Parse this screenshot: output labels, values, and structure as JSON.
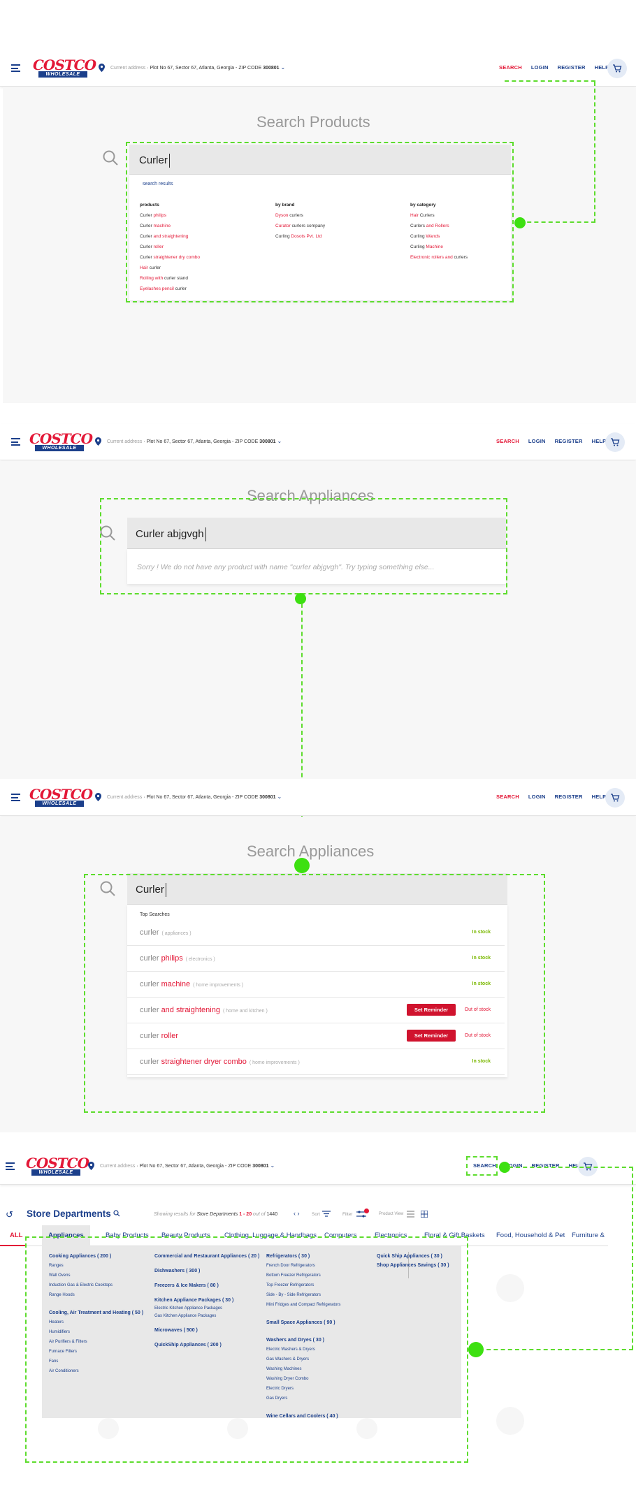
{
  "header": {
    "logo_text": "COSTCO",
    "logo_subtext": "WHOLESALE",
    "address_label": "Current address",
    "address": "Plot No 67, Sector 67, Atlanta, Georgia",
    "zip_label": "ZIP CODE",
    "zip": "300801",
    "nav": {
      "search": "SEARCH",
      "login": "LOGIN",
      "register": "REGISTER",
      "help": "HELP"
    }
  },
  "panel1": {
    "title": "Search Products",
    "query": "Curler",
    "results_link": "search results",
    "columns": [
      {
        "heading": "products",
        "rows": [
          {
            "base": "Curler ",
            "hl": "philips",
            "tail": ""
          },
          {
            "base": "Curler ",
            "hl": "machine",
            "tail": ""
          },
          {
            "base": "Curler ",
            "hl": "and straightening",
            "tail": ""
          },
          {
            "base": "Curler ",
            "hl": "roller",
            "tail": ""
          },
          {
            "base": "Curler ",
            "hl": "straightener dry combo",
            "tail": ""
          },
          {
            "base": "",
            "hl": "Hair",
            "tail": " curler"
          },
          {
            "base": "",
            "hl": "Rolling with",
            "tail": " curler stand"
          },
          {
            "base": "",
            "hl": "Eyelashes pencil",
            "tail": " curler"
          }
        ]
      },
      {
        "heading": "by brand",
        "rows": [
          {
            "base": "",
            "hl": "Dyson",
            "tail": " curlers"
          },
          {
            "base": "",
            "hl": "Curator",
            "tail": " curlers company"
          },
          {
            "base": "Curling ",
            "hl": "Dosots Pvt. Ltd",
            "tail": ""
          }
        ]
      },
      {
        "heading": "by category",
        "rows": [
          {
            "base": "",
            "hl": "Hair",
            "tail": " Curlers"
          },
          {
            "base": "Curlers ",
            "hl": "and Rollers",
            "tail": ""
          },
          {
            "base": "Curling ",
            "hl": "Wands",
            "tail": ""
          },
          {
            "base": "Curling ",
            "hl": "Machine",
            "tail": ""
          },
          {
            "base": "",
            "hl": "Electronic rollers and",
            "tail": " curlers"
          }
        ]
      }
    ]
  },
  "panel2": {
    "title": "Search Appliances",
    "query": "Curler abjgvgh",
    "message": "Sorry ! We do not have any product with name \"curler abjgvgh\". Try typing something else..."
  },
  "panel3": {
    "title": "Search Appliances",
    "query": "Curler",
    "top_label": "Top Searches",
    "reminder_label": "Set Reminder",
    "rows": [
      {
        "base": "curler",
        "hl": "",
        "cat": "( appliances )",
        "status": "In stock",
        "oos": false
      },
      {
        "base": "curler ",
        "hl": "philips",
        "cat": "( electronics )",
        "status": "In stock",
        "oos": false
      },
      {
        "base": "curler ",
        "hl": "machine",
        "cat": "( home improvements )",
        "status": "In stock",
        "oos": false
      },
      {
        "base": "curler ",
        "hl": "and straightening",
        "cat": "( home and kitchen )",
        "status": "Out of stock",
        "oos": true
      },
      {
        "base": "curler ",
        "hl": "roller",
        "cat": "",
        "status": "Out of stock",
        "oos": true
      },
      {
        "base": "curler ",
        "hl": "straightener dryer combo",
        "cat": "( home improvements )",
        "status": "In stock",
        "oos": false
      }
    ]
  },
  "panel4": {
    "title": "Store Departments",
    "showing": "Showing results for",
    "showing_dept": "Store Departments",
    "range": "1 - 20",
    "out_of": "out of",
    "total": "1440",
    "sort_label": "Sort",
    "filter_label": "Filter",
    "view_label": "Product View",
    "tabs": [
      "ALL",
      "Appliances",
      "Baby Products",
      "Beauty Products",
      "Clothing, Luggage & Handbags",
      "Computers",
      "Electronics",
      "Floral & Gift Baskets",
      "Food, Household & Pet",
      "Furniture &"
    ],
    "mega": {
      "col1": [
        {
          "g": "Cooking Appliances ( 200 )",
          "subs": [
            "Ranges",
            "Wall Ovens",
            "Induction Gas & Electric Cooktops",
            "Range Hoods"
          ]
        },
        {
          "g": "Cooling, Air Treatment and Heating ( 50 )",
          "subs": [
            "Heaters",
            "Humidifiers",
            "Air Purifiers & Filters",
            "Furnace Filters",
            "Fans",
            "Air Conditioners"
          ]
        }
      ],
      "col2": [
        {
          "g": "Commercial and Restaurant Appliances ( 20 )",
          "subs": []
        },
        {
          "g": "Dishwashers ( 300 )",
          "subs": []
        },
        {
          "g": "Freezers & Ice Makers ( 80 )",
          "subs": []
        },
        {
          "g": "Kitchen Appliance Packages ( 30 )",
          "subs": [
            "Electric Kitchen Appliance Packages",
            "Gas Kitchen Appliance Packages"
          ]
        },
        {
          "g": "Microwaves ( 500 )",
          "subs": []
        },
        {
          "g": "QuickShip Appliances ( 200 )",
          "subs": []
        }
      ],
      "col3": [
        {
          "g": "Refrigerators ( 30 )",
          "subs": [
            "French Door Refrigerators",
            "Bottom Freezer Refrigerators",
            "Top Freezer Refrigerators",
            "Side - By - Side Refrigerators",
            "Mini Fridges and Compact Refrigerators"
          ]
        },
        {
          "g": "Small Space Appliances ( 90 )",
          "subs": []
        },
        {
          "g": "Washers and Dryes ( 30 )",
          "subs": [
            "Electric Washers & Dryers",
            "Gas Washers & Dryers",
            "Washing Machines",
            "Washing Dryer Combo",
            "Electric Dryers",
            "Gas Dryers"
          ]
        },
        {
          "g": "Wine Cellars and Coolers ( 40 )",
          "subs": []
        }
      ],
      "col4": [
        {
          "g": "Quick Ship Appliances ( 30 )",
          "subs": []
        },
        {
          "g": "Shop Appliances Savings ( 30 )",
          "subs": []
        }
      ]
    }
  }
}
